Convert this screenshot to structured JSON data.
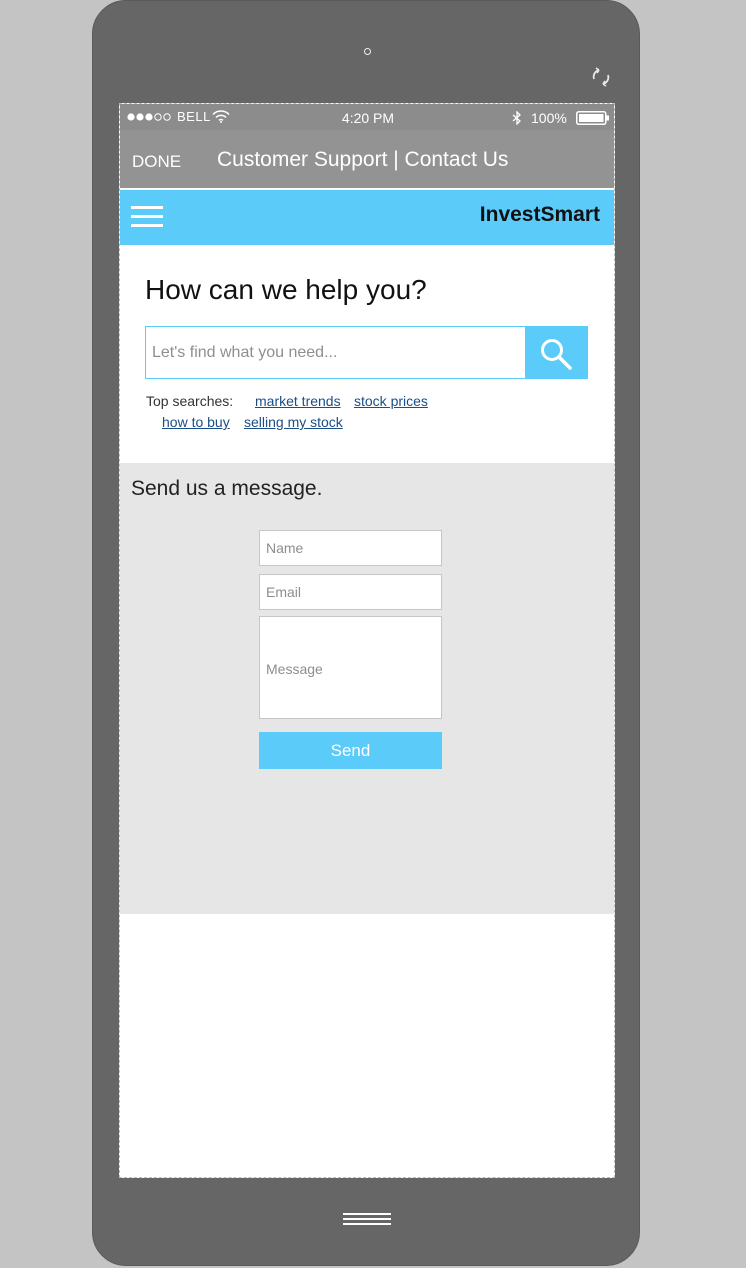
{
  "status_bar": {
    "carrier": "BELL",
    "time": "4:20 PM",
    "battery": "100%"
  },
  "title_bar": {
    "done_label": "DONE",
    "title": "Customer Support | Contact Us"
  },
  "app_header": {
    "brand": "InvestSmart"
  },
  "help": {
    "heading": "How can we help you?",
    "search_placeholder": "Let's find what you need...",
    "top_searches_label": "Top searches:",
    "links": [
      "market trends",
      "stock prices",
      "how to buy",
      "selling my stock"
    ]
  },
  "contact_form": {
    "heading": "Send us a message.",
    "name_placeholder": "Name",
    "email_placeholder": "Email",
    "message_placeholder": "Message",
    "send_label": "Send"
  },
  "colors": {
    "accent": "#5bcbfa",
    "title_bar": "#939393",
    "status_bar": "#8c8c8c",
    "link": "#1b4e86",
    "panel": "#e6e6e6"
  },
  "icons": [
    "camera-icon",
    "rotate-icon",
    "signal-icon",
    "wifi-icon",
    "bluetooth-icon",
    "battery-icon",
    "menu-icon",
    "search-icon",
    "home-button-icon"
  ]
}
